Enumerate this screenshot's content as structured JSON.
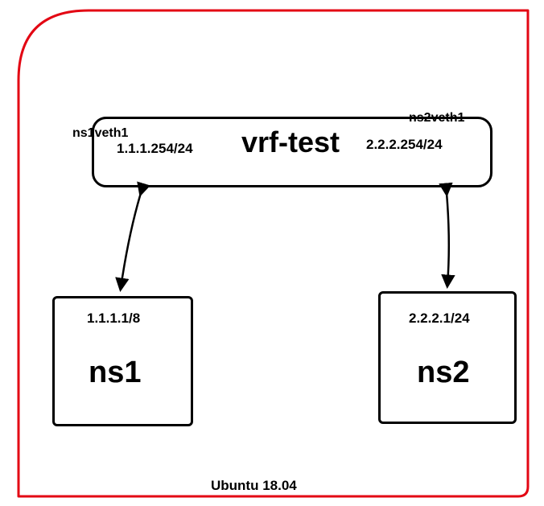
{
  "vrf": {
    "title": "vrf-test",
    "left_interface": "ns1veth1",
    "left_ip": "1.1.1.254/24",
    "right_interface": "ns2veth1",
    "right_ip": "2.2.2.254/24"
  },
  "ns1": {
    "name": "ns1",
    "ip": "1.1.1.1/8"
  },
  "ns2": {
    "name": "ns2",
    "ip": "2.2.2.1/24"
  },
  "os": "Ubuntu 18.04"
}
